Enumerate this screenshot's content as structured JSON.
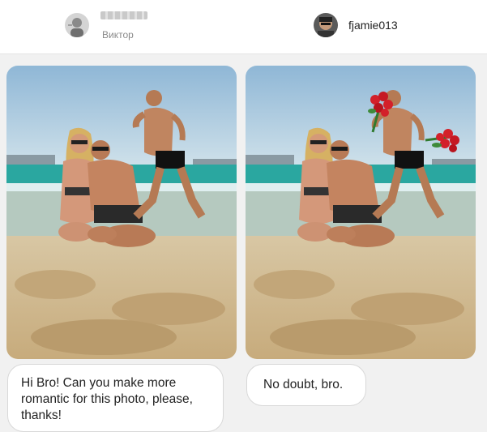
{
  "left_user": {
    "name_redacted": true,
    "sublabel": "Виктор",
    "avatar_icon": "user-avatar-icon"
  },
  "right_user": {
    "name": "fjamie013",
    "avatar_icon": "user-avatar-icon"
  },
  "left_post": {
    "image": "beach-original-photo",
    "message": "Hi Bro! Can you make more romantic for this photo, please, thanks!"
  },
  "right_post": {
    "image": "beach-edited-photo-with-roses",
    "message": "No doubt, bro."
  },
  "colors": {
    "sky": "#b9d3e4",
    "sea": "#2aa7a0",
    "sand": "#d9c8a6",
    "roses": "#d3202a"
  }
}
